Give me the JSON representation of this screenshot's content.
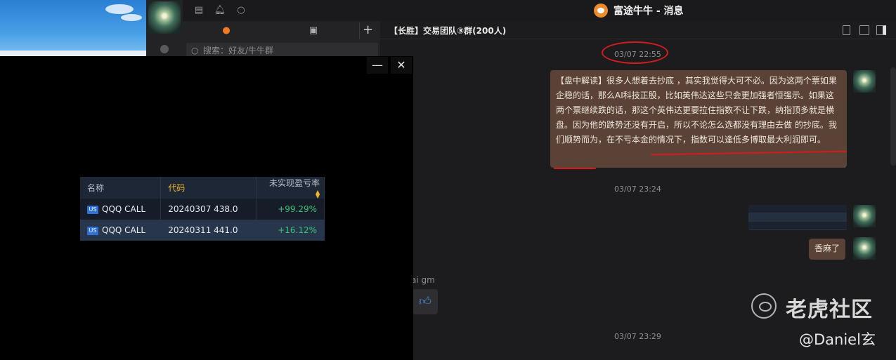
{
  "app": {
    "title": "富途牛牛 - 消息",
    "logo_icon": "futu-logo-icon"
  },
  "search": {
    "placeholder": "搜索：好友/牛牛群"
  },
  "chat": {
    "title": "【长胜】交易团队③群(200人)",
    "timestamps": [
      "03/07 22:55",
      "03/07 23:24",
      "03/07 23:29"
    ],
    "main_message": "【盘中解读】很多人想着去抄底                 ，其实我觉得大可不必。因为这两个票如果企稳的话，那么AI科技正股，比如英伟达这些只会更加强者恒强示。如果这两个票继续跌的话，那这个英伟达更要拉住指数不让下跌，纳指顶多就是横盘。因为他的跌势还没有开启，所以不论怎么选都没有理由去做        的抄底。我们顺势而为，在不亏本金的情况下，指数可以逢低多博取最大利润即可。",
    "reply_message": "香麻了",
    "sender_partial": "ai gm",
    "thumbs_icon": "thumbs-up-icon"
  },
  "watermark": {
    "brand": "老虎社区",
    "user": "@Daniel玄"
  },
  "positions": {
    "headers": {
      "name": "名称",
      "code": "代码",
      "pnl": "未实现盈亏率"
    },
    "rows": [
      {
        "market": "US",
        "name": "QQQ CALL",
        "code": "20240307 438.0",
        "pnl": "+99.29%"
      },
      {
        "market": "US",
        "name": "QQQ CALL",
        "code": "20240311 441.0",
        "pnl": "+16.12%"
      }
    ]
  },
  "colors": {
    "bubble": "#5a4236",
    "annotation": "#d41c1c",
    "gain": "#37c47a",
    "accent": "#f0b429",
    "us_badge": "#2f6fd8"
  }
}
